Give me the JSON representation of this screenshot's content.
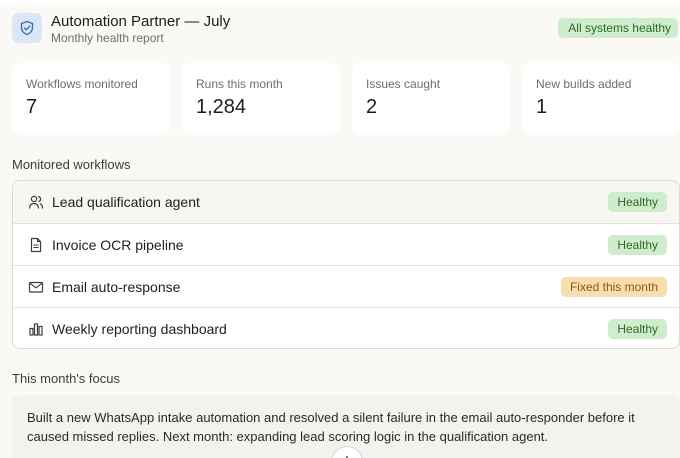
{
  "header": {
    "title": "Automation Partner — July",
    "subtitle": "Monthly health report",
    "status": "All systems healthy",
    "logo_icon": "shield-icon"
  },
  "stats": [
    {
      "label": "Workflows monitored",
      "value": "7"
    },
    {
      "label": "Runs this month",
      "value": "1,284"
    },
    {
      "label": "Issues caught",
      "value": "2"
    },
    {
      "label": "New builds added",
      "value": "1"
    }
  ],
  "workflows": {
    "heading": "Monitored workflows",
    "items": [
      {
        "name": "Lead qualification agent",
        "status": "Healthy",
        "icon": "users-icon"
      },
      {
        "name": "Invoice OCR pipeline",
        "status": "Healthy",
        "icon": "document-icon"
      },
      {
        "name": "Email auto-response",
        "status": "Fixed this month",
        "icon": "mail-icon"
      },
      {
        "name": "Weekly reporting dashboard",
        "status": "Healthy",
        "icon": "bar-chart-icon"
      }
    ]
  },
  "focus": {
    "heading": "This month's focus",
    "body": "Built a new WhatsApp intake automation and resolved a silent failure in the email auto-responder before it caused missed replies. Next month: expanding lead scoring logic in the qualification agent."
  },
  "colors": {
    "healthy_bg": "#cfeccd",
    "healthy_text": "#2e6b23",
    "fixed_bg": "#f8ddaf",
    "fixed_text": "#8a5a12",
    "logo_bg": "#dbe7f7",
    "logo_stroke": "#3a6fb5"
  }
}
